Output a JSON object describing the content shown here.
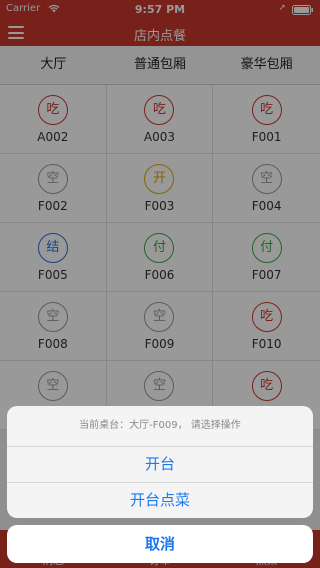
{
  "status": {
    "carrier": "Carrier",
    "time": "9:57 PM"
  },
  "nav": {
    "title": "店内点餐"
  },
  "tabs": [
    "大厅",
    "普通包厢",
    "豪华包厢"
  ],
  "colors": {
    "red": "#c9372c",
    "gray": "#999999",
    "yellow": "#e0a800",
    "blue": "#2d6cdf",
    "green": "#3aa844",
    "action": "#1d78f0"
  },
  "tables": [
    {
      "status": "吃",
      "id": "A002",
      "color": "red"
    },
    {
      "status": "吃",
      "id": "A003",
      "color": "red"
    },
    {
      "status": "吃",
      "id": "F001",
      "color": "red"
    },
    {
      "status": "空",
      "id": "F002",
      "color": "gray"
    },
    {
      "status": "开",
      "id": "F003",
      "color": "yellow"
    },
    {
      "status": "空",
      "id": "F004",
      "color": "gray"
    },
    {
      "status": "结",
      "id": "F005",
      "color": "blue"
    },
    {
      "status": "付",
      "id": "F006",
      "color": "green"
    },
    {
      "status": "付",
      "id": "F007",
      "color": "green"
    },
    {
      "status": "空",
      "id": "F008",
      "color": "gray"
    },
    {
      "status": "空",
      "id": "F009",
      "color": "gray"
    },
    {
      "status": "吃",
      "id": "F010",
      "color": "red"
    },
    {
      "status": "空",
      "id": "",
      "color": "gray"
    },
    {
      "status": "空",
      "id": "",
      "color": "gray"
    },
    {
      "status": "吃",
      "id": "",
      "color": "red"
    }
  ],
  "bottom_tabs": [
    "消息",
    "订单",
    "点菜"
  ],
  "sheet": {
    "message": "当前桌台：大厅-F009， 请选择操作",
    "actions": [
      "开台",
      "开台点菜"
    ],
    "cancel": "取消"
  }
}
